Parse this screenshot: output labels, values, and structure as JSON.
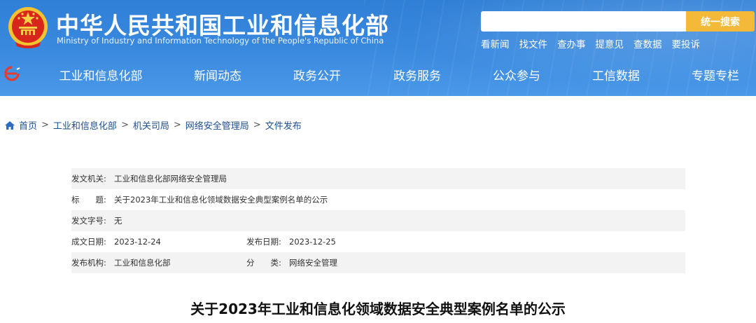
{
  "header": {
    "title": "中华人民共和国工业和信息化部",
    "subtitle": "Ministry of Industry and Information Technology of the People's Republic of China",
    "search": {
      "placeholder": "",
      "button_label": "统一搜索"
    },
    "quick_links": [
      "看新闻",
      "找文件",
      "查办事",
      "提意见",
      "查数据",
      "要投诉"
    ]
  },
  "nav": {
    "items": [
      "工业和信息化部",
      "新闻动态",
      "政务公开",
      "政务服务",
      "公众参与",
      "工信数据",
      "专题专栏"
    ]
  },
  "breadcrumb": [
    "首页",
    "工业和信息化部",
    "机关司局",
    "网络安全管理局",
    "文件发布"
  ],
  "meta": {
    "issuer": {
      "label": "发文机关:",
      "value": "工业和信息化部网络安全管理局"
    },
    "title": {
      "label": "标　　题:",
      "value": "关于2023年工业和信息化领域数据安全典型案例名单的公示"
    },
    "doc_number": {
      "label": "发文字号:",
      "value": "无"
    },
    "created": {
      "label": "成文日期:",
      "value": "2023-12-24"
    },
    "published": {
      "label": "发布日期:",
      "value": "2023-12-25"
    },
    "agency": {
      "label": "发布机构:",
      "value": "工业和信息化部"
    },
    "category": {
      "label": "分　　类:",
      "value": "网络安全管理"
    }
  },
  "document": {
    "title": "关于2023年工业和信息化领域数据安全典型案例名单的公示"
  },
  "colors": {
    "header_blue": "#3a8ae0",
    "search_button": "#f5b93a",
    "breadcrumb_link": "#1f4f8f",
    "row_shade": "#f3f3f3"
  }
}
